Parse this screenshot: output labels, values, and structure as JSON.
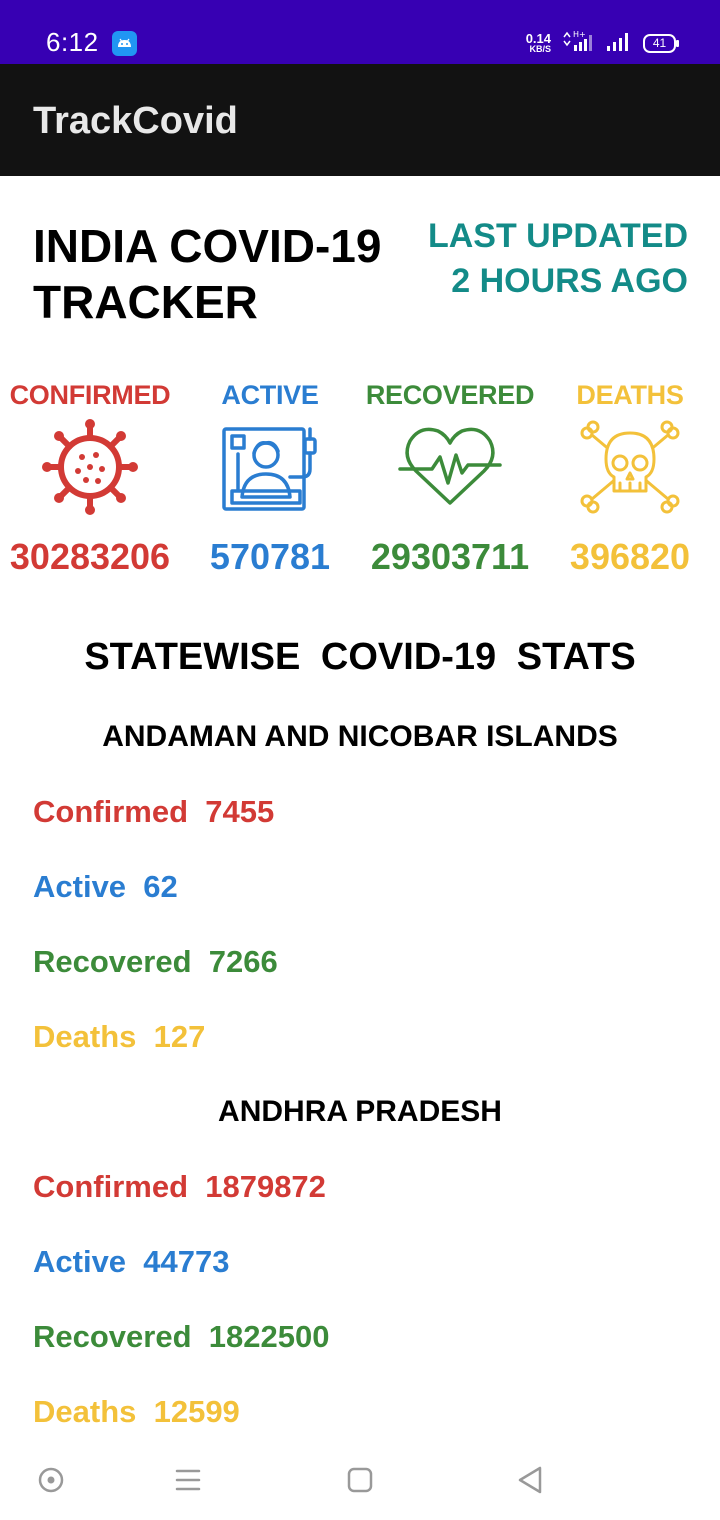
{
  "status_bar": {
    "time": "6:12",
    "net_speed_value": "0.14",
    "net_speed_unit": "KB/S",
    "network": "H+",
    "battery": "41"
  },
  "app_bar": {
    "title": "TrackCovid"
  },
  "header": {
    "title_line1": "INDIA COVID-19",
    "title_line2": "TRACKER",
    "updated_line1": "LAST UPDATED",
    "updated_line2": "2 HOURS AGO"
  },
  "national": {
    "confirmed": {
      "label": "CONFIRMED",
      "value": "30283206",
      "icon": "virus-icon"
    },
    "active": {
      "label": "ACTIVE",
      "value": "570781",
      "icon": "patient-bed-icon"
    },
    "recovered": {
      "label": "RECOVERED",
      "value": "29303711",
      "icon": "heartbeat-icon"
    },
    "deaths": {
      "label": "DEATHS",
      "value": "396820",
      "icon": "skull-crossbones-icon"
    }
  },
  "statewise": {
    "title": "STATEWISE  COVID-19  STATS",
    "states": [
      {
        "name": "ANDAMAN AND NICOBAR ISLANDS",
        "confirmed": "Confirmed  7455",
        "active": "Active  62",
        "recovered": "Recovered  7266",
        "deaths": "Deaths  127"
      },
      {
        "name": "ANDHRA PRADESH",
        "confirmed": "Confirmed  1879872",
        "active": "Active  44773",
        "recovered": "Recovered  1822500",
        "deaths": "Deaths  12599"
      }
    ]
  },
  "colors": {
    "confirmed": "#d23a35",
    "active": "#2a7dd1",
    "recovered": "#3c8b3a",
    "deaths": "#f3c13a",
    "accent": "#138b88",
    "status_bar": "#3700b3",
    "app_bar": "#121212"
  },
  "nav_bar": {
    "icons": [
      "home-circle-icon",
      "menu-icon",
      "recents-square-icon",
      "back-triangle-icon"
    ]
  }
}
